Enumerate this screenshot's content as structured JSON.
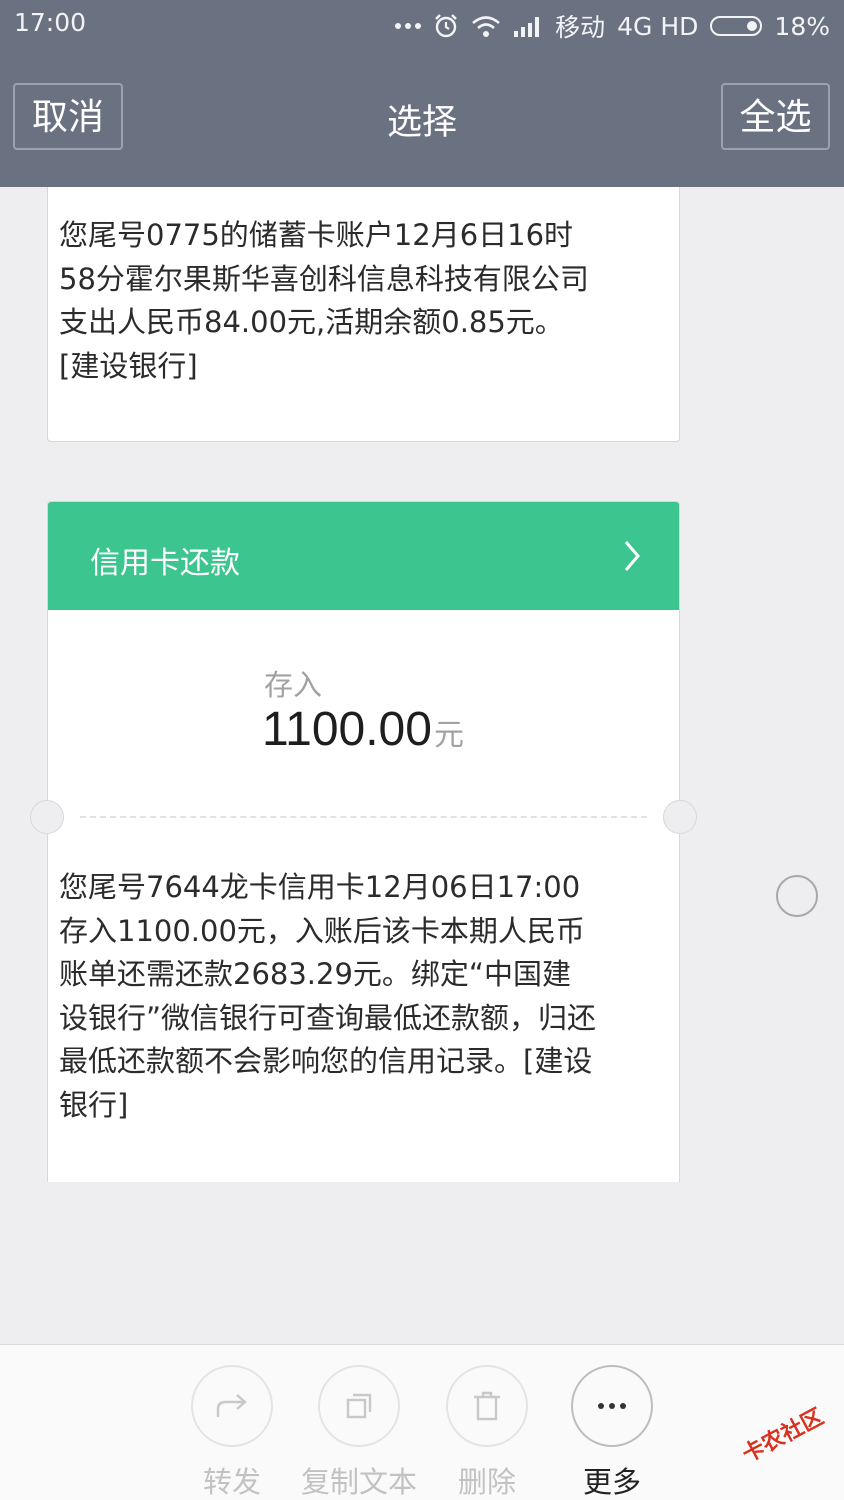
{
  "status_bar": {
    "time": "17:00",
    "carrier": "移动",
    "network": "4G HD",
    "battery": "18%"
  },
  "nav": {
    "cancel_label": "取消",
    "title": "选择",
    "select_all_label": "全选"
  },
  "messages": [
    {
      "text": "您尾号0775的储蓄卡账户12月6日16时58分霍尔果斯华喜创科信息科技有限公司支出人民币84.00元,活期余额0.85元。[建设银行]"
    },
    {
      "header": "信用卡还款",
      "deposit_label": "存入",
      "amount": "1100.00",
      "unit": "元",
      "text": "您尾号7644龙卡信用卡12月06日17:00存入1100.00元，入账后该卡本期人民币账单还需还款2683.29元。绑定“中国建设银行”微信银行可查询最低还款额，归还最低还款额不会影响您的信用记录。[建设银行]"
    }
  ],
  "toolbar": {
    "forward": "转发",
    "copy": "复制文本",
    "delete": "删除",
    "more": "更多"
  },
  "watermark": "卡农社区",
  "colors": {
    "header_bg": "#6a7180",
    "accent_green": "#3dc58f",
    "page_bg": "#eeeef0"
  }
}
